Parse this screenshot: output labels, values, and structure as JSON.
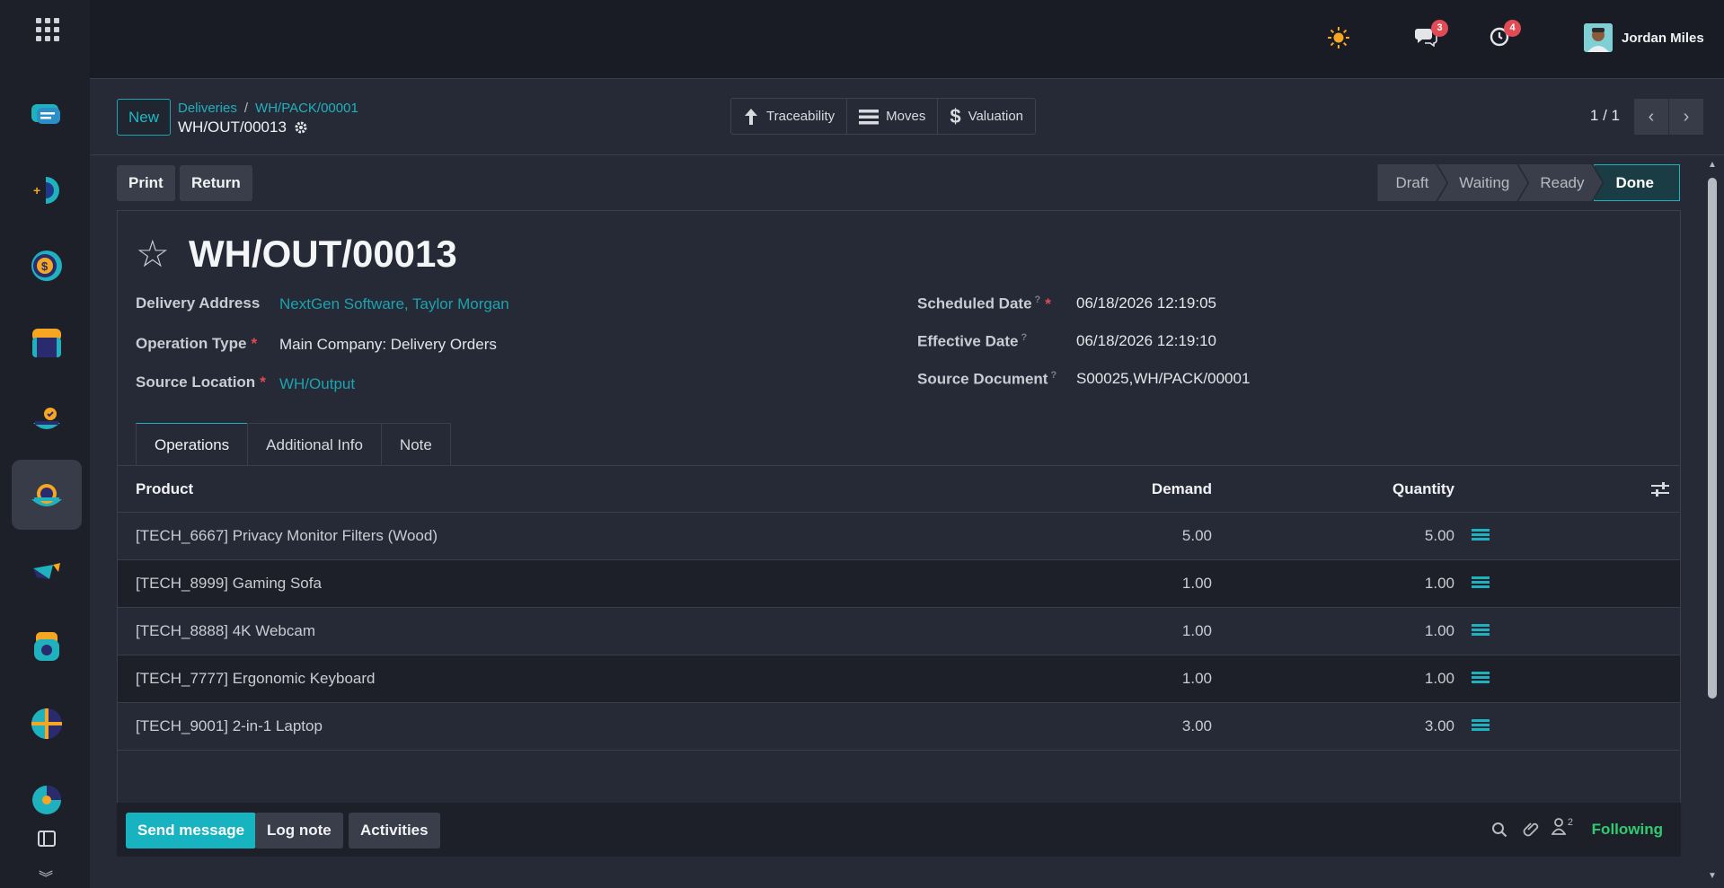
{
  "topbar": {
    "messages_count": "3",
    "activities_count": "4",
    "user_name": "Jordan Miles"
  },
  "control_panel": {
    "new_label": "New",
    "breadcrumb": [
      "Deliveries",
      "WH/PACK/00001"
    ],
    "record_name": "WH/OUT/00013",
    "smart_buttons": [
      {
        "label": "Traceability",
        "icon": "arrow-up-icon"
      },
      {
        "label": "Moves",
        "icon": "list-icon"
      },
      {
        "label": "Valuation",
        "icon": "dollar-icon"
      }
    ],
    "pager": "1 / 1"
  },
  "actions": {
    "print": "Print",
    "return": "Return"
  },
  "status_stages": [
    "Draft",
    "Waiting",
    "Ready",
    "Done"
  ],
  "status_current": "Done",
  "form": {
    "title": "WH/OUT/00013",
    "labels": {
      "delivery_address": "Delivery Address",
      "operation_type": "Operation Type",
      "source_location": "Source Location",
      "scheduled_date": "Scheduled Date",
      "effective_date": "Effective Date",
      "source_document": "Source Document"
    },
    "values": {
      "delivery_address": "NextGen Software, Taylor Morgan",
      "operation_type": "Main Company: Delivery Orders",
      "source_location": "WH/Output",
      "scheduled_date": "06/18/2026 12:19:05",
      "effective_date": "06/18/2026 12:19:10",
      "source_document": "S00025,WH/PACK/00001"
    }
  },
  "tabs": [
    "Operations",
    "Additional Info",
    "Note"
  ],
  "table": {
    "headers": {
      "product": "Product",
      "demand": "Demand",
      "quantity": "Quantity"
    },
    "rows": [
      {
        "product": "[TECH_6667] Privacy Monitor Filters (Wood)",
        "demand": "5.00",
        "quantity": "5.00"
      },
      {
        "product": "[TECH_8999] Gaming Sofa",
        "demand": "1.00",
        "quantity": "1.00"
      },
      {
        "product": "[TECH_8888] 4K Webcam",
        "demand": "1.00",
        "quantity": "1.00"
      },
      {
        "product": "[TECH_7777] Ergonomic Keyboard",
        "demand": "1.00",
        "quantity": "1.00"
      },
      {
        "product": "[TECH_9001] 2-in-1 Laptop",
        "demand": "3.00",
        "quantity": "3.00"
      }
    ]
  },
  "chatter": {
    "send_message": "Send message",
    "log_note": "Log note",
    "activities": "Activities",
    "followers_count": "2",
    "following": "Following"
  },
  "colors": {
    "accent": "#1fb1bd",
    "background": "#262a36",
    "following": "#2ecc71",
    "badge": "#e04b55"
  }
}
